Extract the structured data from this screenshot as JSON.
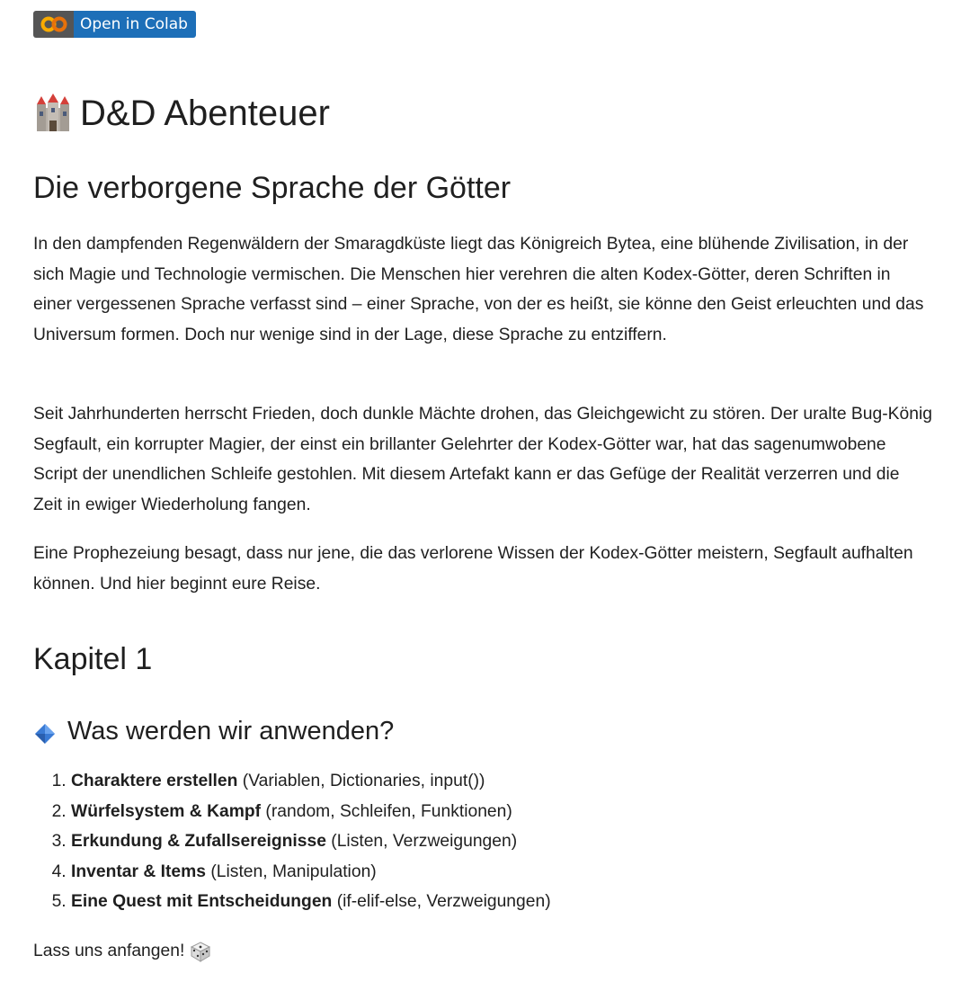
{
  "badge": {
    "label": "Open in Colab",
    "logo_text": "CO",
    "logo_icon": "colab-logo-icon",
    "colors": {
      "logo_bg": "#555555",
      "label_bg": "#1d6fb8",
      "logo_fill": "#f9ab00"
    }
  },
  "title": {
    "icon": "castle-icon",
    "text": "D&D Abenteuer"
  },
  "subtitle": "Die verborgene Sprache der Götter",
  "paragraphs": [
    "In den dampfenden Regenwäldern der Smaragdküste liegt das Königreich Bytea, eine blühende Zivilisation, in der sich Magie und Technologie vermischen. Die Menschen hier verehren die alten Kodex-Götter, deren Schriften in einer vergessenen Sprache verfasst sind – einer Sprache, von der es heißt, sie könne den Geist erleuchten und das Universum formen. Doch nur wenige sind in der Lage, diese Sprache zu entziffern.",
    "Seit Jahrhunderten herrscht Frieden, doch dunkle Mächte drohen, das Gleichgewicht zu stören. Der uralte Bug-König Segfault, ein korrupter Magier, der einst ein brillanter Gelehrter der Kodex-Götter war, hat das sagenumwobene Script der unendlichen Schleife gestohlen. Mit diesem Artefakt kann er das Gefüge der Realität verzerren und die Zeit in ewiger Wiederholung fangen.",
    "Eine Prophezeiung besagt, dass nur jene, die das verlorene Wissen der Kodex-Götter meistern, Segfault aufhalten können. Und hier beginnt eure Reise."
  ],
  "chapter": "Kapitel 1",
  "section": {
    "icon": "blue-diamond-icon",
    "heading": "Was werden wir anwenden?"
  },
  "topics": [
    {
      "bold": "Charaktere erstellen",
      "rest": " (Variablen, Dictionaries, input())"
    },
    {
      "bold": "Würfelsystem & Kampf",
      "rest": " (random, Schleifen, Funktionen)"
    },
    {
      "bold": "Erkundung & Zufallsereignisse",
      "rest": " (Listen, Verzweigungen)"
    },
    {
      "bold": "Inventar & Items",
      "rest": " (Listen, Manipulation)"
    },
    {
      "bold": "Eine Quest mit Entscheidungen",
      "rest": " (if-elif-else, Verzweigungen)"
    }
  ],
  "closing": {
    "text": "Lass uns anfangen!",
    "icon": "dice-icon"
  }
}
